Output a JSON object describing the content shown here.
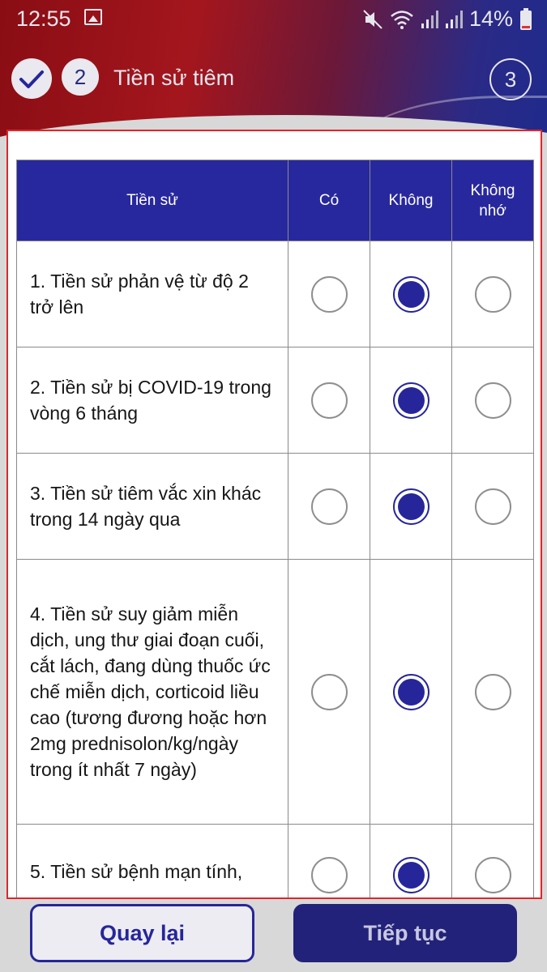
{
  "status_bar": {
    "time": "12:55",
    "battery": "14%",
    "icons": [
      "image-icon",
      "mute-icon",
      "wifi-icon",
      "signal-icon",
      "signal-icon",
      "battery-icon"
    ]
  },
  "steps": {
    "current_number": "2",
    "current_title": "Tiền sử tiêm",
    "next_number": "3"
  },
  "table": {
    "headers": [
      "Tiền sử",
      "Có",
      "Không",
      "Không nhớ"
    ],
    "rows": [
      {
        "question": "1. Tiền sử phản vệ từ độ 2 trở lên",
        "selected": "Không"
      },
      {
        "question": "2. Tiền sử bị COVID-19 trong vòng 6 tháng",
        "selected": "Không"
      },
      {
        "question": "3. Tiền sử tiêm vắc xin khác trong 14 ngày qua",
        "selected": "Không"
      },
      {
        "question": "4. Tiền sử suy giảm miễn dịch, ung thư giai đoạn cuối, cắt lách, đang dùng thuốc ức chế miễn dịch, corticoid liều cao (tương đương hoặc hơn 2mg prednisolon/kg/ngày trong ít nhất 7 ngày)",
        "selected": "Không"
      },
      {
        "question": "5. Tiền sử bệnh mạn tính,",
        "selected": "Không"
      }
    ]
  },
  "footer": {
    "back_label": "Quay lại",
    "next_label": "Tiếp tục"
  },
  "colors": {
    "accent": "#26269a",
    "highlight_border": "#e0252a"
  }
}
